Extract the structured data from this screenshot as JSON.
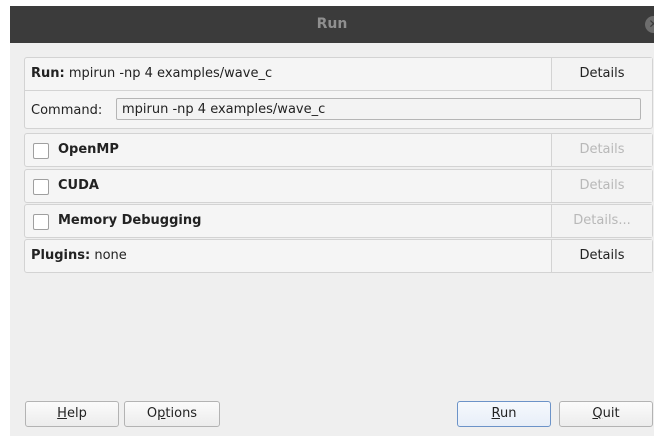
{
  "window": {
    "title": "Run"
  },
  "run": {
    "label": "Run:",
    "value": "mpirun -np 4 examples/wave_c",
    "details": "Details",
    "command_label": "Command:",
    "command_value": "mpirun -np 4 examples/wave_c"
  },
  "openmp": {
    "label": "OpenMP",
    "checked": false,
    "details": "Details"
  },
  "cuda": {
    "label": "CUDA",
    "checked": false,
    "details": "Details"
  },
  "memory": {
    "label": "Memory Debugging",
    "checked": false,
    "details": "Details..."
  },
  "plugins": {
    "label": "Plugins:",
    "value": "none",
    "details": "Details"
  },
  "buttons": {
    "help": {
      "mnemonic": "H",
      "rest": "elp"
    },
    "options": {
      "pre": "O",
      "mnemonic": "p",
      "rest": "tions"
    },
    "run": {
      "mnemonic": "R",
      "rest": "un"
    },
    "quit": {
      "mnemonic": "Q",
      "rest": "uit"
    }
  }
}
